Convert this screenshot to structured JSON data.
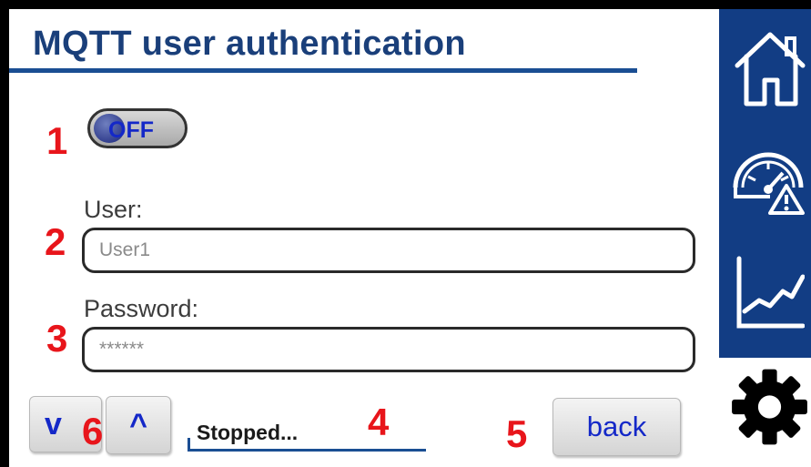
{
  "header": {
    "title": "MQTT user authentication"
  },
  "markers": {
    "m1": "1",
    "m2": "2",
    "m3": "3",
    "m4": "4",
    "m5": "5",
    "m6": "6"
  },
  "toggle": {
    "state": "OFF"
  },
  "user": {
    "label": "User:",
    "value": "User1"
  },
  "password": {
    "label": "Password:",
    "value": "******"
  },
  "nav": {
    "down_label": "v",
    "up_label": "^",
    "back_label": "back"
  },
  "status": {
    "text": "Stopped..."
  },
  "sidebar": {
    "items": [
      "home-icon",
      "gauge-warning-icon",
      "chart-icon",
      "gear-icon"
    ]
  },
  "colors": {
    "accent": "#123d84",
    "title": "#1a3f7a",
    "marker": "#e8151b",
    "button_text": "#1428c8"
  }
}
